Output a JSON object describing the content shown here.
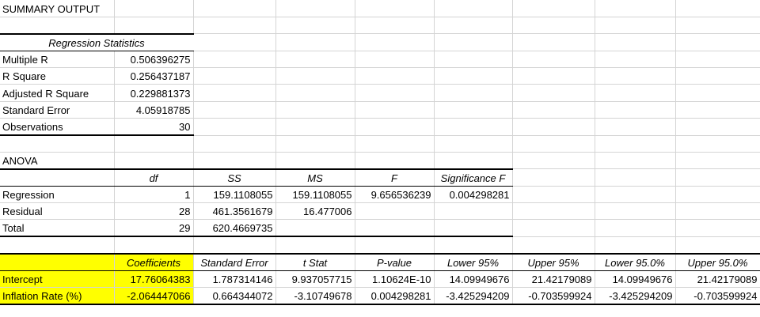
{
  "title": "SUMMARY OUTPUT",
  "regression_statistics": {
    "header": "Regression Statistics",
    "rows": [
      {
        "label": "Multiple R",
        "value": "0.506396275"
      },
      {
        "label": "R Square",
        "value": "0.256437187"
      },
      {
        "label": "Adjusted R Square",
        "value": "0.229881373"
      },
      {
        "label": "Standard Error",
        "value": "4.05918785"
      },
      {
        "label": "Observations",
        "value": "30"
      }
    ]
  },
  "anova": {
    "title": "ANOVA",
    "headers": [
      "df",
      "SS",
      "MS",
      "F",
      "Significance F"
    ],
    "rows": [
      {
        "label": "Regression",
        "df": "1",
        "ss": "159.1108055",
        "ms": "159.1108055",
        "f": "9.656536239",
        "sig": "0.004298281"
      },
      {
        "label": "Residual",
        "df": "28",
        "ss": "461.3561679",
        "ms": "16.477006",
        "f": "",
        "sig": ""
      },
      {
        "label": "Total",
        "df": "29",
        "ss": "620.4669735",
        "ms": "",
        "f": "",
        "sig": ""
      }
    ]
  },
  "coefficients": {
    "headers": [
      "Coefficients",
      "Standard Error",
      "t Stat",
      "P-value",
      "Lower 95%",
      "Upper 95%",
      "Lower 95.0%",
      "Upper 95.0%"
    ],
    "rows": [
      {
        "label": "Intercept",
        "values": [
          "17.76064383",
          "1.787314146",
          "9.937057715",
          "1.10624E-10",
          "14.09949676",
          "21.42179089",
          "14.09949676",
          "21.42179089"
        ]
      },
      {
        "label": "Inflation Rate (%)",
        "values": [
          "-2.064447066",
          "0.664344072",
          "-3.10749678",
          "0.004298281",
          "-3.425294209",
          "-0.703599924",
          "-3.425294209",
          "-0.703599924"
        ]
      }
    ]
  },
  "colors": {
    "highlight": "#ffff00",
    "gridline": "#d4d4d4"
  }
}
